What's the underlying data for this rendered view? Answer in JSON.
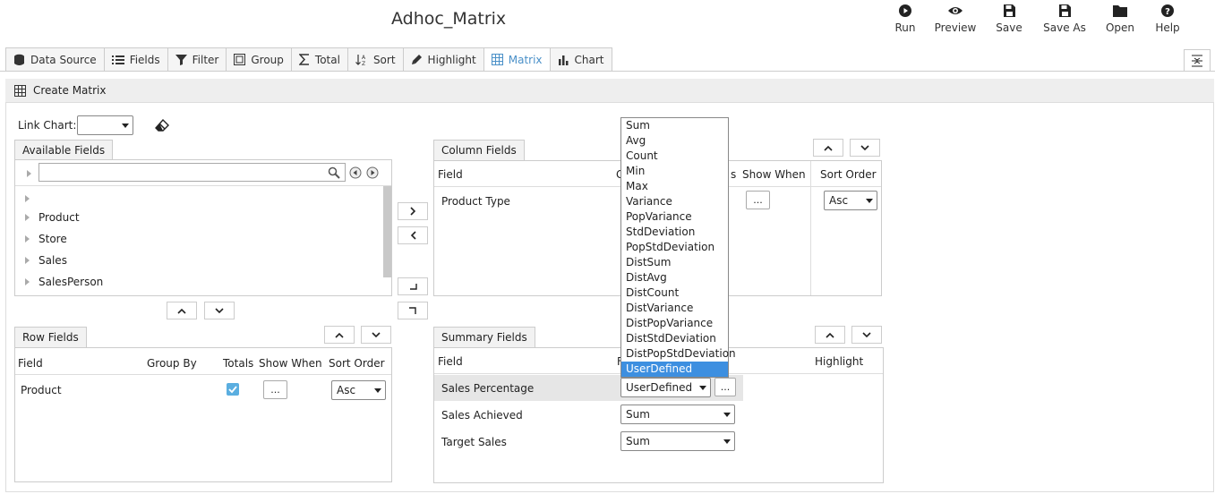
{
  "app": {
    "title": "Adhoc_Matrix"
  },
  "toolbar": {
    "run": "Run",
    "preview": "Preview",
    "save": "Save",
    "save_as": "Save As",
    "open": "Open",
    "help": "Help"
  },
  "tabs": [
    {
      "label": "Data Source",
      "icon": "database-icon"
    },
    {
      "label": "Fields",
      "icon": "list-icon"
    },
    {
      "label": "Filter",
      "icon": "filter-icon"
    },
    {
      "label": "Group",
      "icon": "group-icon"
    },
    {
      "label": "Total",
      "icon": "sigma-icon"
    },
    {
      "label": "Sort",
      "icon": "sort-icon"
    },
    {
      "label": "Highlight",
      "icon": "highlighter-icon"
    },
    {
      "label": "Matrix",
      "icon": "grid-icon",
      "active": true
    },
    {
      "label": "Chart",
      "icon": "bar-chart-icon"
    }
  ],
  "panel": {
    "title": "Create Matrix"
  },
  "link_chart": {
    "label": "Link Chart:",
    "value": ""
  },
  "available_fields": {
    "tab": "Available Fields",
    "search_value": "",
    "items": [
      "Product",
      "Store",
      "Sales",
      "SalesPerson"
    ]
  },
  "column_fields": {
    "tab": "Column Fields",
    "headers": {
      "field": "Field",
      "group_by": "G",
      "totals": "s",
      "show_when": "Show When",
      "sort_order": "Sort Order"
    },
    "rows": [
      {
        "field": "Product Type",
        "show_when": "...",
        "sort_order": "Asc"
      }
    ]
  },
  "row_fields": {
    "tab": "Row Fields",
    "headers": {
      "field": "Field",
      "group_by": "Group By",
      "totals": "Totals",
      "show_when": "Show When",
      "sort_order": "Sort Order"
    },
    "rows": [
      {
        "field": "Product",
        "totals_checked": true,
        "show_when": "...",
        "sort_order": "Asc"
      }
    ]
  },
  "summary_fields": {
    "tab": "Summary Fields",
    "headers": {
      "field": "Field",
      "function": "F",
      "highlight": "Highlight"
    },
    "rows": [
      {
        "field": "Sales Percentage",
        "function": "UserDefined",
        "extra": "..."
      },
      {
        "field": "Sales Achieved",
        "function": "Sum"
      },
      {
        "field": "Target Sales",
        "function": "Sum"
      }
    ]
  },
  "function_dropdown": {
    "options": [
      "Sum",
      "Avg",
      "Count",
      "Min",
      "Max",
      "Variance",
      "PopVariance",
      "StdDeviation",
      "PopStdDeviation",
      "DistSum",
      "DistAvg",
      "DistCount",
      "DistVariance",
      "DistPopVariance",
      "DistStdDeviation",
      "DistPopStdDeviation",
      "UserDefined"
    ],
    "selected": "UserDefined"
  },
  "colors": {
    "accent": "#4a90c8",
    "selected_option": "#3d8fe0",
    "checkbox": "#5aaee0"
  }
}
